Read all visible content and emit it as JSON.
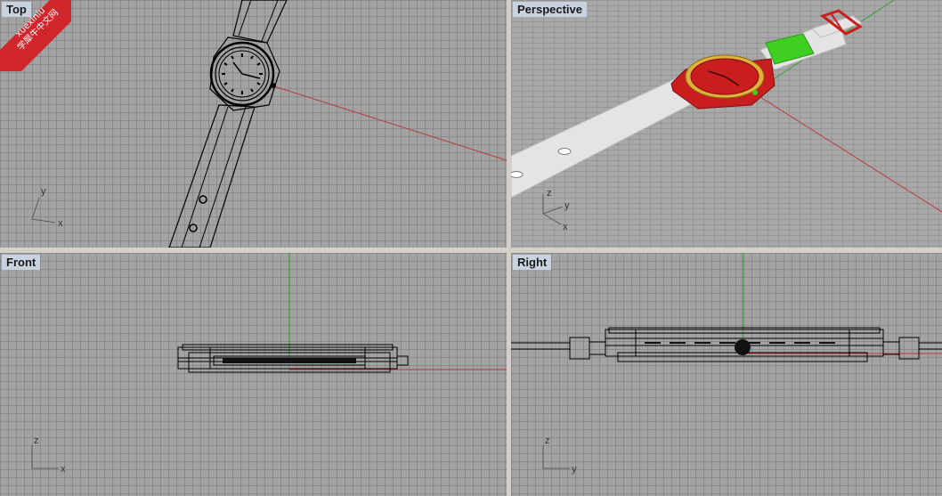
{
  "viewports": {
    "top": {
      "title": "Top"
    },
    "perspective": {
      "title": "Perspective"
    },
    "front": {
      "title": "Front"
    },
    "right": {
      "title": "Right"
    }
  },
  "axes": {
    "top": {
      "v": "y",
      "h": "x"
    },
    "perspective": {
      "z": "z",
      "y": "y",
      "x": "x"
    },
    "front": {
      "v": "z",
      "h": "x"
    },
    "right": {
      "v": "z",
      "h": "y"
    }
  },
  "watermark": {
    "line1": "xuexiniu",
    "line2": "学犀牛中文网"
  },
  "colors": {
    "grid_bg": "#a3a3a3",
    "x_axis": "#b83a3a",
    "y_axis": "#2fa12f",
    "watch_case": "#c81e1e",
    "watch_bezel": "#e0b23a",
    "strap": "#e4e4e4",
    "strap_highlight": "#3ecf22"
  }
}
